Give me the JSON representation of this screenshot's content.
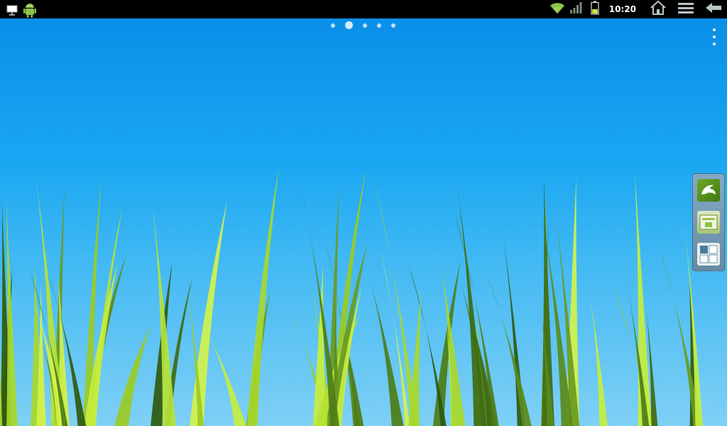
{
  "statusbar": {
    "time": "10:20",
    "left_icons": [
      "presentation-notification-icon",
      "android-notification-icon"
    ],
    "right_icons": [
      "wifi-icon",
      "signal-icon",
      "battery-icon",
      "home-icon",
      "menu-icon",
      "back-icon"
    ]
  },
  "desktop": {
    "wallpaper": "grass",
    "page_count": 5,
    "current_page": 2,
    "dock_items": [
      "dolphin-browser-icon",
      "app-drawer-icon",
      "widget-grid-icon"
    ]
  }
}
